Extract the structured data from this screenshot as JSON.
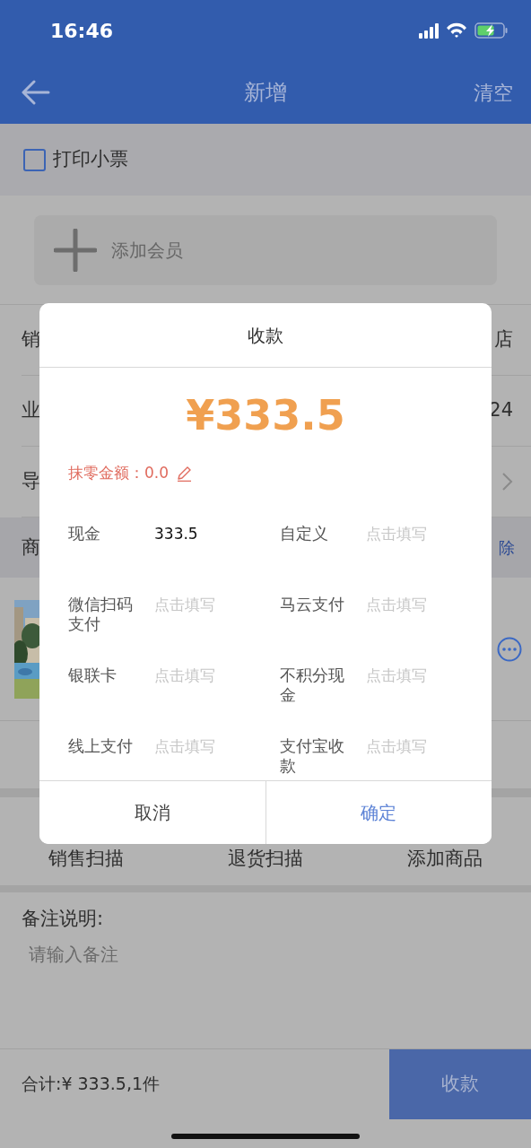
{
  "status_bar": {
    "time": "16:46"
  },
  "header": {
    "title": "新增",
    "action": "清空"
  },
  "print_receipt": {
    "label": "打印小票",
    "checked": false
  },
  "add_member": {
    "label": "添加会员"
  },
  "form_rows": [
    {
      "kind": "text",
      "label": "销",
      "value": "店"
    },
    {
      "kind": "text",
      "label": "业",
      "value": "24"
    },
    {
      "kind": "link",
      "label": "导"
    }
  ],
  "products_header": {
    "label": "商",
    "action": "除"
  },
  "actions": [
    "销售扫描",
    "退货扫描",
    "添加商品"
  ],
  "remark": {
    "label": "备注说明:",
    "placeholder": "请输入备注"
  },
  "footer": {
    "total": "合计:¥ 333.5,1件",
    "button": "收款"
  },
  "dialog": {
    "title": "收款",
    "amount": "¥333.5",
    "rounding": "抹零金额：0.0",
    "payments": [
      {
        "label": "现金",
        "value": "333.5"
      },
      {
        "label": "自定义",
        "placeholder": "点击填写"
      },
      {
        "label": "微信扫码支付",
        "placeholder": "点击填写"
      },
      {
        "label": "马云支付",
        "placeholder": "点击填写"
      },
      {
        "label": "银联卡",
        "placeholder": "点击填写"
      },
      {
        "label": "不积分现金",
        "placeholder": "点击填写"
      },
      {
        "label": "线上支付",
        "placeholder": "点击填写"
      },
      {
        "label": "支付宝收款",
        "placeholder": "点击填写"
      }
    ],
    "buttons": [
      {
        "label": "取消",
        "kind": "cancel"
      },
      {
        "label": "确定",
        "kind": "confirm"
      }
    ]
  }
}
